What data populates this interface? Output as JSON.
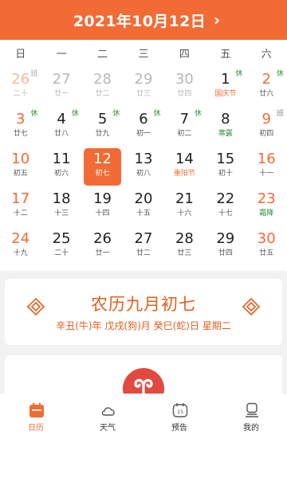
{
  "header": {
    "title": "2021年10月12日",
    "arrow": "›"
  },
  "weekdays": [
    "日",
    "一",
    "二",
    "三",
    "四",
    "五",
    "六"
  ],
  "weeks": [
    [
      {
        "n": "26",
        "s": "二十",
        "other": true,
        "weekend": true,
        "badge": "班",
        "badgeType": "work"
      },
      {
        "n": "27",
        "s": "廿一",
        "other": true
      },
      {
        "n": "28",
        "s": "廿二",
        "other": true
      },
      {
        "n": "29",
        "s": "廿三",
        "other": true
      },
      {
        "n": "30",
        "s": "廿四",
        "other": true
      },
      {
        "n": "1",
        "s": "国庆节",
        "fest": true,
        "badge": "休",
        "badgeType": "rest"
      },
      {
        "n": "2",
        "s": "廿六",
        "weekend": true,
        "badge": "休",
        "badgeType": "rest"
      }
    ],
    [
      {
        "n": "3",
        "s": "廿七",
        "weekend": true,
        "badge": "休",
        "badgeType": "rest"
      },
      {
        "n": "4",
        "s": "廿八",
        "badge": "休",
        "badgeType": "rest"
      },
      {
        "n": "5",
        "s": "廿九",
        "badge": "休",
        "badgeType": "rest"
      },
      {
        "n": "6",
        "s": "初一",
        "badge": "休",
        "badgeType": "rest"
      },
      {
        "n": "7",
        "s": "初二",
        "badge": "休",
        "badgeType": "rest"
      },
      {
        "n": "8",
        "s": "寒露",
        "term": true
      },
      {
        "n": "9",
        "s": "初四",
        "weekend": true,
        "badge": "班",
        "badgeType": "work"
      }
    ],
    [
      {
        "n": "10",
        "s": "初五",
        "weekend": true
      },
      {
        "n": "11",
        "s": "初六"
      },
      {
        "n": "12",
        "s": "初七",
        "selected": true
      },
      {
        "n": "13",
        "s": "初八"
      },
      {
        "n": "14",
        "s": "重阳节",
        "fest": true
      },
      {
        "n": "15",
        "s": "初十"
      },
      {
        "n": "16",
        "s": "十一",
        "weekend": true
      }
    ],
    [
      {
        "n": "17",
        "s": "十二",
        "weekend": true
      },
      {
        "n": "18",
        "s": "十三"
      },
      {
        "n": "19",
        "s": "十四"
      },
      {
        "n": "20",
        "s": "十五"
      },
      {
        "n": "21",
        "s": "十六"
      },
      {
        "n": "22",
        "s": "十七"
      },
      {
        "n": "23",
        "s": "霜降",
        "weekend": true,
        "term": true
      }
    ],
    [
      {
        "n": "24",
        "s": "十九",
        "weekend": true
      },
      {
        "n": "25",
        "s": "二十"
      },
      {
        "n": "26",
        "s": "廿一"
      },
      {
        "n": "27",
        "s": "廿二"
      },
      {
        "n": "28",
        "s": "廿三"
      },
      {
        "n": "29",
        "s": "廿四"
      },
      {
        "n": "30",
        "s": "廿五",
        "weekend": true
      }
    ]
  ],
  "lunar": {
    "main": "农历九月初七",
    "sub": "辛丑(牛)年 戊戌(狗)月 癸巳(蛇)日 星期二"
  },
  "tabs": [
    {
      "label": "日历",
      "icon": "calendar-icon",
      "active": true
    },
    {
      "label": "天气",
      "icon": "cloud-icon",
      "active": false
    },
    {
      "label": "预告",
      "icon": "forecast-icon",
      "active": false
    },
    {
      "label": "我的",
      "icon": "profile-icon",
      "active": false
    }
  ],
  "colors": {
    "accent": "#f26b35",
    "rest": "#2d8c3c",
    "lunar": "#e0601f",
    "mascot": "#e14a40"
  }
}
